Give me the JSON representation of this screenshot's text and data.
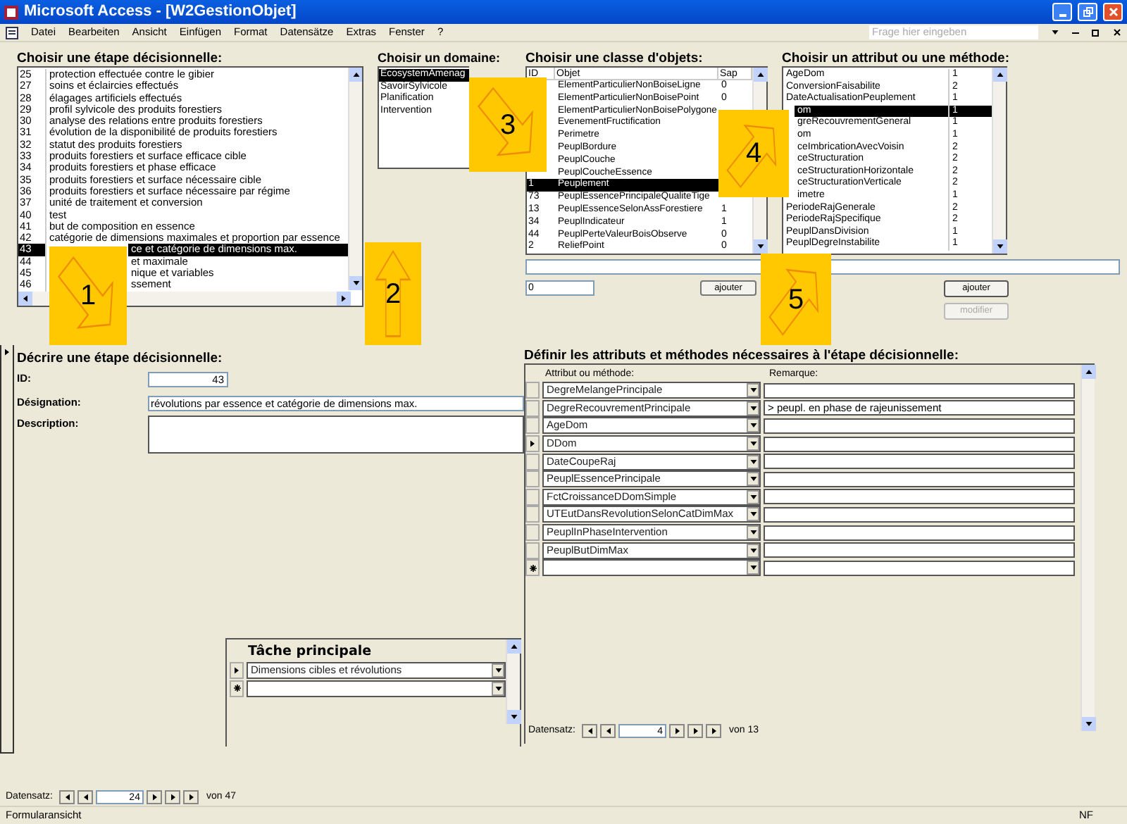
{
  "window": {
    "title": "Microsoft Access - [W2GestionObjet]"
  },
  "menu": [
    "Datei",
    "Bearbeiten",
    "Ansicht",
    "Einfügen",
    "Format",
    "Datensätze",
    "Extras",
    "Fenster",
    "?"
  ],
  "help_box": {
    "placeholder": "Frage hier eingeben"
  },
  "steps": {
    "heading": "Choisir une étape décisionnelle:",
    "rows": [
      {
        "id": "25",
        "text": "protection effectuée contre le gibier",
        "selected": false,
        "under_callout": false
      },
      {
        "id": "27",
        "text": "soins et éclaircies effectués",
        "selected": false,
        "under_callout": false
      },
      {
        "id": "28",
        "text": "élagages artificiels effectués",
        "selected": false,
        "under_callout": false
      },
      {
        "id": "29",
        "text": "profil sylvicole des produits forestiers",
        "selected": false,
        "under_callout": false
      },
      {
        "id": "30",
        "text": "analyse des relations entre produits forestiers",
        "selected": false,
        "under_callout": false
      },
      {
        "id": "31",
        "text": "évolution de la disponibilité de produits forestiers",
        "selected": false,
        "under_callout": false
      },
      {
        "id": "32",
        "text": "statut des produits forestiers",
        "selected": false,
        "under_callout": false
      },
      {
        "id": "33",
        "text": "produits forestiers et surface efficace cible",
        "selected": false,
        "under_callout": false
      },
      {
        "id": "34",
        "text": "produits forestiers et phase efficace",
        "selected": false,
        "under_callout": false
      },
      {
        "id": "35",
        "text": "produits forestiers et surface nécessaire cible",
        "selected": false,
        "under_callout": false
      },
      {
        "id": "36",
        "text": "produits forestiers et surface nécessaire par régime",
        "selected": false,
        "under_callout": false
      },
      {
        "id": "37",
        "text": "unité de traitement et conversion",
        "selected": false,
        "under_callout": false
      },
      {
        "id": "40",
        "text": "test",
        "selected": false,
        "under_callout": false
      },
      {
        "id": "41",
        "text": "but de composition en essence",
        "selected": false,
        "under_callout": false
      },
      {
        "id": "42",
        "text": "catégorie de dimensions maximales et proportion par essence",
        "selected": false,
        "under_callout": false
      },
      {
        "id": "43",
        "text": "ce et catégorie de dimensions max.",
        "selected": true,
        "under_callout": true
      },
      {
        "id": "44",
        "text": "et maximale",
        "selected": false,
        "under_callout": true
      },
      {
        "id": "45",
        "text": "nique et variables",
        "selected": false,
        "under_callout": true
      },
      {
        "id": "46",
        "text": "ssement",
        "selected": false,
        "under_callout": true
      }
    ]
  },
  "domains": {
    "heading": "Choisir un domaine:",
    "items": [
      {
        "text": "EcosystemAmenag",
        "selected": true
      },
      {
        "text": "SavoirSylvicole",
        "selected": false
      },
      {
        "text": "Planification",
        "selected": false
      },
      {
        "text": "Intervention",
        "selected": false
      }
    ]
  },
  "classes": {
    "heading": "Choisir une classe d'objets:",
    "columns": [
      "ID",
      "Objet",
      "Sap"
    ],
    "rows": [
      {
        "objet": "ElementParticulierNonBoiseLigne",
        "sap": "0",
        "selected": false
      },
      {
        "objet": "ElementParticulierNonBoisePoint",
        "sap": "0",
        "selected": false
      },
      {
        "objet": "ElementParticulierNonBoisePolygone",
        "selected": false
      },
      {
        "objet": "EvenementFructification",
        "selected": false
      },
      {
        "objet": "Perimetre",
        "selected": false
      },
      {
        "objet": "PeuplBordure",
        "selected": false
      },
      {
        "objet": "PeuplCouche",
        "selected": false
      },
      {
        "objet": "PeuplCoucheEssence",
        "selected": false
      },
      {
        "id": "1",
        "objet": "Peuplement",
        "selected": true
      },
      {
        "id": "73",
        "objet": "PeuplEssencePrincipaleQualiteTige",
        "selected": false
      },
      {
        "id": "13",
        "objet": "PeuplEssenceSelonAssForestiere",
        "sap": "1",
        "selected": false
      },
      {
        "id": "34",
        "objet": "PeuplIndicateur",
        "sap": "1",
        "selected": false
      },
      {
        "id": "44",
        "objet": "PeuplPerteValeurBoisObserve",
        "sap": "0",
        "selected": false
      },
      {
        "id": "2",
        "objet": "ReliefPoint",
        "sap": "0",
        "selected": false
      }
    ],
    "number_field": "0",
    "add_button": "ajouter"
  },
  "attributes": {
    "heading": "Choisir un attribut ou une méthode:",
    "rows": [
      {
        "name": "AgeDom",
        "count": "1",
        "selected": false,
        "under_callout": false
      },
      {
        "name": "ConversionFaisabilite",
        "count": "2",
        "selected": false,
        "under_callout": false
      },
      {
        "name": "DateActualisationPeuplement",
        "count": "1",
        "selected": false,
        "under_callout": false
      },
      {
        "name": "om",
        "count": "1",
        "selected": true,
        "under_callout": true
      },
      {
        "name": "greRecouvrementGeneral",
        "count": "1",
        "selected": false,
        "under_callout": true
      },
      {
        "name": "om",
        "count": "1",
        "selected": false,
        "under_callout": true
      },
      {
        "name": "ceImbricationAvecVoisin",
        "count": "2",
        "selected": false,
        "under_callout": true
      },
      {
        "name": "ceStructuration",
        "count": "2",
        "selected": false,
        "under_callout": true
      },
      {
        "name": "ceStructurationHorizontale",
        "count": "2",
        "selected": false,
        "under_callout": true
      },
      {
        "name": "ceStructurationVerticale",
        "count": "2",
        "selected": false,
        "under_callout": true
      },
      {
        "name": "imetre",
        "count": "1",
        "selected": false,
        "under_callout": true
      },
      {
        "name": "PeriodeRajGenerale",
        "count": "2",
        "selected": false,
        "under_callout": false
      },
      {
        "name": "PeriodeRajSpecifique",
        "count": "2",
        "selected": false,
        "under_callout": false
      },
      {
        "name": "PeuplDansDivision",
        "count": "1",
        "selected": false,
        "under_callout": false
      },
      {
        "name": "PeuplDegreInstabilite",
        "count": "1",
        "selected": false,
        "under_callout": false
      }
    ],
    "buttons": [
      {
        "label": "ajouter",
        "disabled": false
      },
      {
        "label": "modifier",
        "disabled": true
      }
    ]
  },
  "describe": {
    "heading": "Décrire une étape décisionnelle:",
    "id_label": "ID:",
    "id_value": "43",
    "designation_label": "Désignation:",
    "designation_value": "révolutions par essence et catégorie de dimensions max.",
    "description_label": "Description:"
  },
  "main_task": {
    "heading": "Tâche principale",
    "rows": [
      {
        "kind": "record",
        "current": true,
        "value": "Dimensions cibles et révolutions"
      },
      {
        "kind": "new"
      }
    ]
  },
  "define": {
    "heading": "Définir les attributs et méthodes nécessaires à l'étape décisionnelle:",
    "columns": [
      "Attribut ou méthode:",
      "Remarque:"
    ],
    "rows": [
      {
        "kind": "record",
        "current": false,
        "attribute": "DegreMelangePrincipale"
      },
      {
        "kind": "record",
        "current": false,
        "attribute": "DegreRecouvrementPrincipale",
        "remark": "> peupl. en phase de rajeunissement"
      },
      {
        "kind": "record",
        "current": false,
        "attribute": "AgeDom"
      },
      {
        "kind": "record",
        "current": true,
        "attribute": "DDom"
      },
      {
        "kind": "record",
        "current": false,
        "attribute": "DateCoupeRaj"
      },
      {
        "kind": "record",
        "current": false,
        "attribute": "PeuplEssencePrincipale"
      },
      {
        "kind": "record",
        "current": false,
        "attribute": "FctCroissanceDDomSimple"
      },
      {
        "kind": "record",
        "current": false,
        "attribute": "UTEutDansRevolutionSelonCatDimMax"
      },
      {
        "kind": "record",
        "current": false,
        "attribute": "PeuplInPhaseIntervention"
      },
      {
        "kind": "record",
        "current": false,
        "attribute": "PeuplButDimMax"
      },
      {
        "kind": "new"
      }
    ],
    "navigator": {
      "label": "Datensatz:",
      "record": "4",
      "total": "von 13"
    }
  },
  "navigator": {
    "label": "Datensatz:",
    "record": "24",
    "total": "von 47"
  },
  "callouts": [
    "1",
    "2",
    "3",
    "4",
    "5"
  ],
  "status_bar": {
    "view": "Formularansicht",
    "mode": "NF"
  }
}
